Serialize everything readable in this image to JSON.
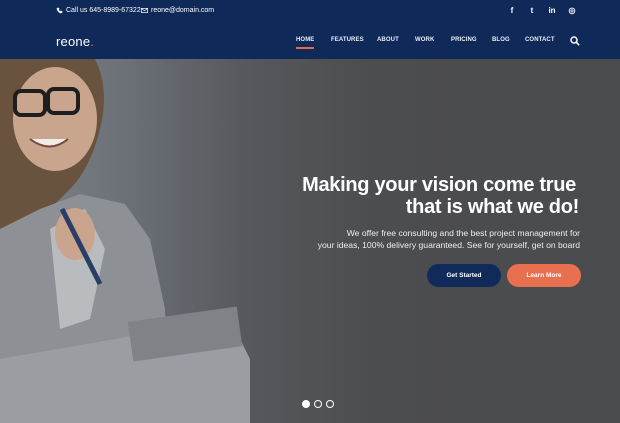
{
  "topbar": {
    "phone": "Call us 645-8989-67322",
    "email": "reone@domain.com",
    "social": [
      {
        "icon": "facebook-icon",
        "glyph": "f"
      },
      {
        "icon": "twitter-icon",
        "glyph": "t"
      },
      {
        "icon": "linkedin-icon",
        "glyph": "in"
      },
      {
        "icon": "instagram-icon",
        "glyph": "◎"
      }
    ]
  },
  "logo": {
    "text": "reone",
    "dot": "."
  },
  "nav": {
    "items": [
      "HOME",
      "FEATURES",
      "ABOUT",
      "WORK",
      "PRICING",
      "BLOG",
      "CONTACT"
    ],
    "active": "HOME"
  },
  "hero": {
    "headline_line1": "Making your vision come true",
    "headline_line2": "that is what we do!",
    "sub_line1": "We offer free consulting and the best project management for",
    "sub_line2": "your ideas, 100% delivery guaranteed. See for yourself, get on board",
    "primary_button": "Get Started",
    "secondary_button": "Learn More",
    "slider": {
      "count": 3,
      "active": 1
    }
  },
  "colors": {
    "header_bg": "#0f2a59",
    "accent": "#e46a4c",
    "primary_button": "#102b5a",
    "secondary_button": "#e9704f"
  }
}
